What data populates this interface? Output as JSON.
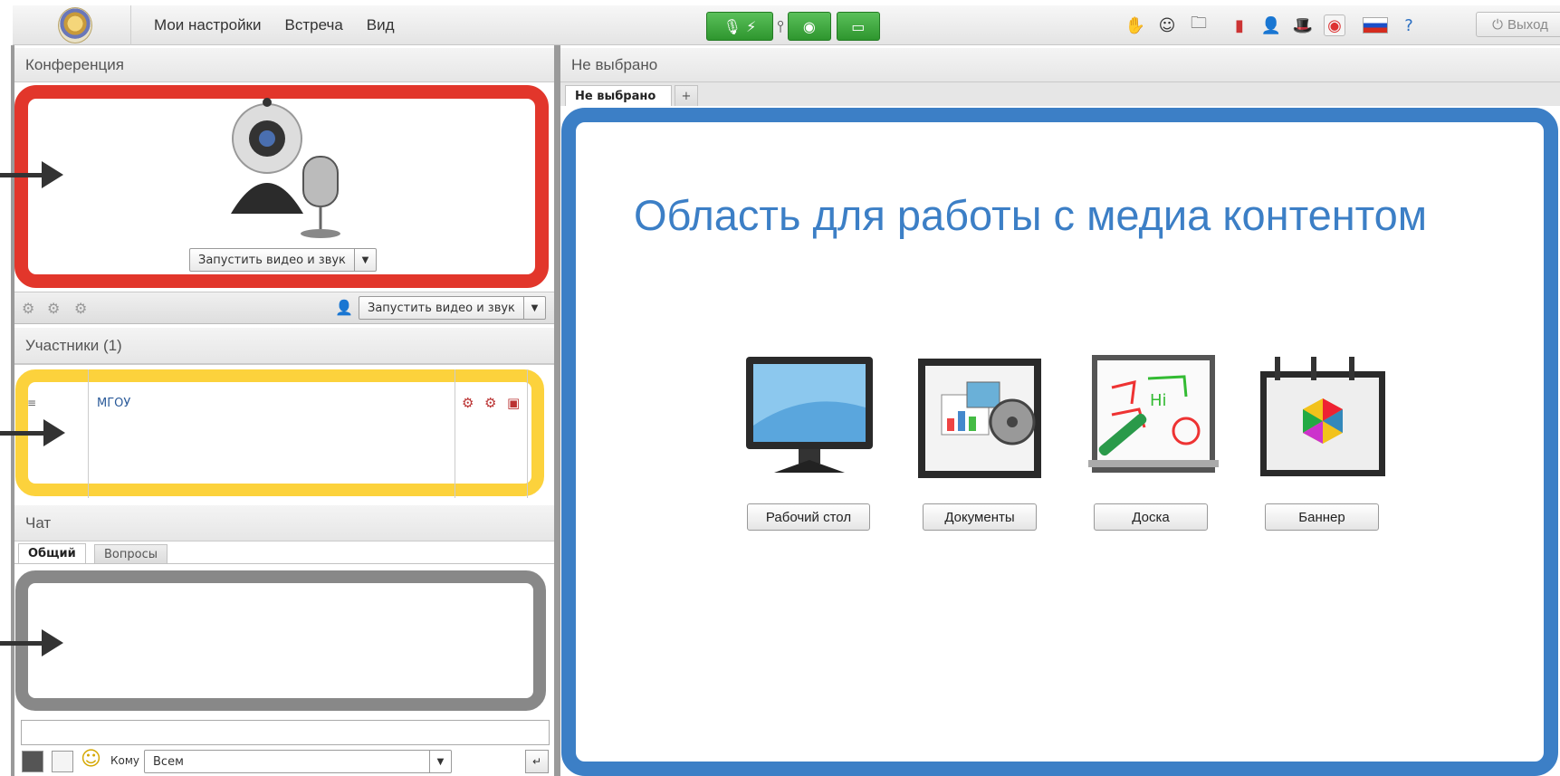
{
  "menu": [
    "Мои настройки",
    "Встреча",
    "Вид"
  ],
  "exit_label": "Выход",
  "conference": {
    "title": "Конференция",
    "start_button": "Запустить видео и звук",
    "start_button_toolbar": "Запустить видео и звук"
  },
  "participants": {
    "title": "Участники (1)",
    "rows": [
      {
        "name": "МГОУ"
      }
    ]
  },
  "chat": {
    "title": "Чат",
    "tabs": [
      "Общий",
      "Вопросы"
    ],
    "to_label": "Кому",
    "to_value": "Всем"
  },
  "workspace": {
    "title": "Не выбрано",
    "tabs": [
      "Не выбрано",
      "+"
    ],
    "heading": "Область для работы с медиа контентом",
    "buttons": [
      "Рабочий стол",
      "Документы",
      "Доска",
      "Баннер"
    ]
  },
  "colors": {
    "conference_frame": "#e2362b",
    "participants_frame": "#fcd23c",
    "chat_frame": "#888888",
    "media_frame": "#3c7fc6"
  }
}
